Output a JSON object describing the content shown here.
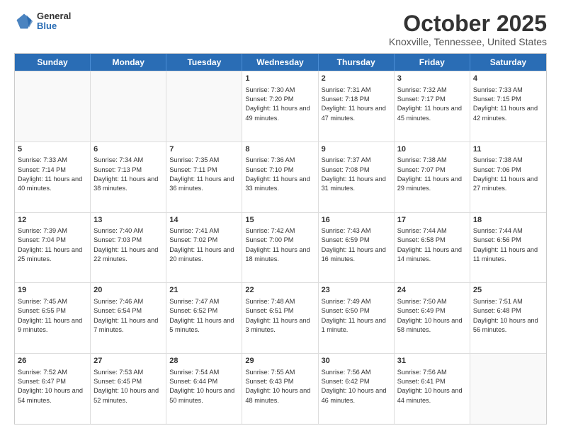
{
  "header": {
    "logo": {
      "general": "General",
      "blue": "Blue"
    },
    "title": "October 2025",
    "subtitle": "Knoxville, Tennessee, United States"
  },
  "weekdays": [
    "Sunday",
    "Monday",
    "Tuesday",
    "Wednesday",
    "Thursday",
    "Friday",
    "Saturday"
  ],
  "rows": [
    [
      {
        "day": "",
        "sunrise": "",
        "sunset": "",
        "daylight": ""
      },
      {
        "day": "",
        "sunrise": "",
        "sunset": "",
        "daylight": ""
      },
      {
        "day": "",
        "sunrise": "",
        "sunset": "",
        "daylight": ""
      },
      {
        "day": "1",
        "sunrise": "Sunrise: 7:30 AM",
        "sunset": "Sunset: 7:20 PM",
        "daylight": "Daylight: 11 hours and 49 minutes."
      },
      {
        "day": "2",
        "sunrise": "Sunrise: 7:31 AM",
        "sunset": "Sunset: 7:18 PM",
        "daylight": "Daylight: 11 hours and 47 minutes."
      },
      {
        "day": "3",
        "sunrise": "Sunrise: 7:32 AM",
        "sunset": "Sunset: 7:17 PM",
        "daylight": "Daylight: 11 hours and 45 minutes."
      },
      {
        "day": "4",
        "sunrise": "Sunrise: 7:33 AM",
        "sunset": "Sunset: 7:15 PM",
        "daylight": "Daylight: 11 hours and 42 minutes."
      }
    ],
    [
      {
        "day": "5",
        "sunrise": "Sunrise: 7:33 AM",
        "sunset": "Sunset: 7:14 PM",
        "daylight": "Daylight: 11 hours and 40 minutes."
      },
      {
        "day": "6",
        "sunrise": "Sunrise: 7:34 AM",
        "sunset": "Sunset: 7:13 PM",
        "daylight": "Daylight: 11 hours and 38 minutes."
      },
      {
        "day": "7",
        "sunrise": "Sunrise: 7:35 AM",
        "sunset": "Sunset: 7:11 PM",
        "daylight": "Daylight: 11 hours and 36 minutes."
      },
      {
        "day": "8",
        "sunrise": "Sunrise: 7:36 AM",
        "sunset": "Sunset: 7:10 PM",
        "daylight": "Daylight: 11 hours and 33 minutes."
      },
      {
        "day": "9",
        "sunrise": "Sunrise: 7:37 AM",
        "sunset": "Sunset: 7:08 PM",
        "daylight": "Daylight: 11 hours and 31 minutes."
      },
      {
        "day": "10",
        "sunrise": "Sunrise: 7:38 AM",
        "sunset": "Sunset: 7:07 PM",
        "daylight": "Daylight: 11 hours and 29 minutes."
      },
      {
        "day": "11",
        "sunrise": "Sunrise: 7:38 AM",
        "sunset": "Sunset: 7:06 PM",
        "daylight": "Daylight: 11 hours and 27 minutes."
      }
    ],
    [
      {
        "day": "12",
        "sunrise": "Sunrise: 7:39 AM",
        "sunset": "Sunset: 7:04 PM",
        "daylight": "Daylight: 11 hours and 25 minutes."
      },
      {
        "day": "13",
        "sunrise": "Sunrise: 7:40 AM",
        "sunset": "Sunset: 7:03 PM",
        "daylight": "Daylight: 11 hours and 22 minutes."
      },
      {
        "day": "14",
        "sunrise": "Sunrise: 7:41 AM",
        "sunset": "Sunset: 7:02 PM",
        "daylight": "Daylight: 11 hours and 20 minutes."
      },
      {
        "day": "15",
        "sunrise": "Sunrise: 7:42 AM",
        "sunset": "Sunset: 7:00 PM",
        "daylight": "Daylight: 11 hours and 18 minutes."
      },
      {
        "day": "16",
        "sunrise": "Sunrise: 7:43 AM",
        "sunset": "Sunset: 6:59 PM",
        "daylight": "Daylight: 11 hours and 16 minutes."
      },
      {
        "day": "17",
        "sunrise": "Sunrise: 7:44 AM",
        "sunset": "Sunset: 6:58 PM",
        "daylight": "Daylight: 11 hours and 14 minutes."
      },
      {
        "day": "18",
        "sunrise": "Sunrise: 7:44 AM",
        "sunset": "Sunset: 6:56 PM",
        "daylight": "Daylight: 11 hours and 11 minutes."
      }
    ],
    [
      {
        "day": "19",
        "sunrise": "Sunrise: 7:45 AM",
        "sunset": "Sunset: 6:55 PM",
        "daylight": "Daylight: 11 hours and 9 minutes."
      },
      {
        "day": "20",
        "sunrise": "Sunrise: 7:46 AM",
        "sunset": "Sunset: 6:54 PM",
        "daylight": "Daylight: 11 hours and 7 minutes."
      },
      {
        "day": "21",
        "sunrise": "Sunrise: 7:47 AM",
        "sunset": "Sunset: 6:52 PM",
        "daylight": "Daylight: 11 hours and 5 minutes."
      },
      {
        "day": "22",
        "sunrise": "Sunrise: 7:48 AM",
        "sunset": "Sunset: 6:51 PM",
        "daylight": "Daylight: 11 hours and 3 minutes."
      },
      {
        "day": "23",
        "sunrise": "Sunrise: 7:49 AM",
        "sunset": "Sunset: 6:50 PM",
        "daylight": "Daylight: 11 hours and 1 minute."
      },
      {
        "day": "24",
        "sunrise": "Sunrise: 7:50 AM",
        "sunset": "Sunset: 6:49 PM",
        "daylight": "Daylight: 10 hours and 58 minutes."
      },
      {
        "day": "25",
        "sunrise": "Sunrise: 7:51 AM",
        "sunset": "Sunset: 6:48 PM",
        "daylight": "Daylight: 10 hours and 56 minutes."
      }
    ],
    [
      {
        "day": "26",
        "sunrise": "Sunrise: 7:52 AM",
        "sunset": "Sunset: 6:47 PM",
        "daylight": "Daylight: 10 hours and 54 minutes."
      },
      {
        "day": "27",
        "sunrise": "Sunrise: 7:53 AM",
        "sunset": "Sunset: 6:45 PM",
        "daylight": "Daylight: 10 hours and 52 minutes."
      },
      {
        "day": "28",
        "sunrise": "Sunrise: 7:54 AM",
        "sunset": "Sunset: 6:44 PM",
        "daylight": "Daylight: 10 hours and 50 minutes."
      },
      {
        "day": "29",
        "sunrise": "Sunrise: 7:55 AM",
        "sunset": "Sunset: 6:43 PM",
        "daylight": "Daylight: 10 hours and 48 minutes."
      },
      {
        "day": "30",
        "sunrise": "Sunrise: 7:56 AM",
        "sunset": "Sunset: 6:42 PM",
        "daylight": "Daylight: 10 hours and 46 minutes."
      },
      {
        "day": "31",
        "sunrise": "Sunrise: 7:56 AM",
        "sunset": "Sunset: 6:41 PM",
        "daylight": "Daylight: 10 hours and 44 minutes."
      },
      {
        "day": "",
        "sunrise": "",
        "sunset": "",
        "daylight": ""
      }
    ]
  ]
}
